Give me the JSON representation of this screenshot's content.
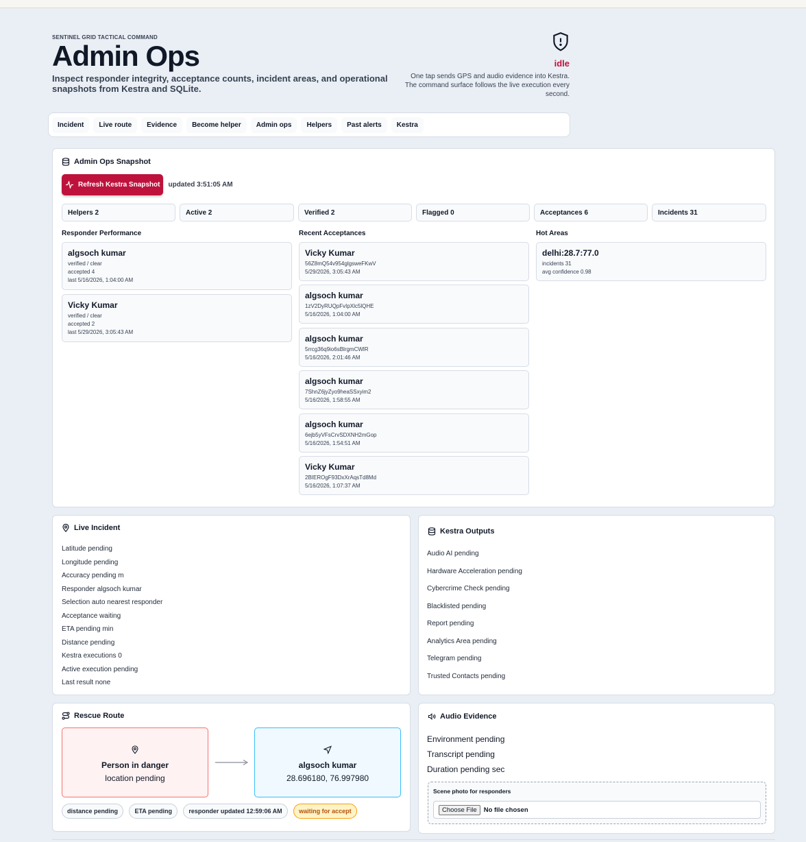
{
  "header": {
    "eyebrow": "SENTINEL GRID TACTICAL COMMAND",
    "title": "Admin Ops",
    "subtitle": "Inspect responder integrity, acceptance counts, incident areas, and operational snapshots from Kestra and SQLite.",
    "status": "idle",
    "status_desc": "One tap sends GPS and audio evidence into Kestra. The command surface follows the live execution every second.",
    "status_color": "#be123c"
  },
  "nav": {
    "tabs": [
      "Incident",
      "Live route",
      "Evidence",
      "Become helper",
      "Admin ops",
      "Helpers",
      "Past alerts",
      "Kestra"
    ]
  },
  "admin": {
    "title": "Admin Ops Snapshot",
    "refresh_label": "Refresh Kestra Snapshot",
    "updated": "updated 3:51:05 AM",
    "stats": [
      "Helpers 2",
      "Active 2",
      "Verified 2",
      "Flagged 0",
      "Acceptances 6",
      "Incidents 31"
    ],
    "performance": {
      "title": "Responder Performance",
      "items": [
        {
          "name": "algsoch kumar",
          "status": "verified / clear",
          "accepted": "accepted 4",
          "last": "last 5/16/2026, 1:04:00 AM"
        },
        {
          "name": "Vicky Kumar",
          "status": "verified / clear",
          "accepted": "accepted 2",
          "last": "last 5/29/2026, 3:05:43 AM"
        }
      ]
    },
    "acceptances": {
      "title": "Recent Acceptances",
      "items": [
        {
          "name": "Vicky Kumar",
          "id": "56Z8mQ54v954glgsweFKwV",
          "time": "5/29/2026, 3:05:43 AM"
        },
        {
          "name": "algsoch kumar",
          "id": "1zV2DyRUQpFvIpXlc5lQHE",
          "time": "5/16/2026, 1:04:00 AM"
        },
        {
          "name": "algsoch kumar",
          "id": "5rrcg36q9io6sBlrgmCWlR",
          "time": "5/16/2026, 2:01:46 AM"
        },
        {
          "name": "algsoch kumar",
          "id": "7ShnZ6jyZyo9heaSSxyim2",
          "time": "5/16/2026, 1:58:55 AM"
        },
        {
          "name": "algsoch kumar",
          "id": "6ejb5yVFsCrvSDXNH2mGop",
          "time": "5/16/2026, 1:54:51 AM"
        },
        {
          "name": "Vicky Kumar",
          "id": "2BIEROgF93DxXrAqsTd8Md",
          "time": "5/16/2026, 1:07:37 AM"
        }
      ]
    },
    "hot_areas": {
      "title": "Hot Areas",
      "items": [
        {
          "name": "delhi:28.7:77.0",
          "incidents": "incidents 31",
          "confidence": "avg confidence 0.98"
        }
      ]
    }
  },
  "live_incident": {
    "title": "Live Incident",
    "fields": [
      "Latitude pending",
      "Longitude pending",
      "Accuracy pending m",
      "Responder algsoch kumar",
      "Selection auto nearest responder",
      "Acceptance waiting",
      "ETA pending min",
      "Distance pending",
      "Kestra executions 0",
      "Active execution pending",
      "Last result none"
    ]
  },
  "kestra_outputs": {
    "title": "Kestra Outputs",
    "fields": [
      "Audio AI pending",
      "Hardware Acceleration pending",
      "Cybercrime Check pending",
      "Blacklisted pending",
      "Report pending",
      "Analytics Area pending",
      "Telegram pending",
      "Trusted Contacts pending"
    ]
  },
  "route": {
    "title": "Rescue Route",
    "from": {
      "title": "Person in danger",
      "detail": "location pending"
    },
    "to": {
      "title": "algsoch kumar",
      "detail": "28.696180, 76.997980"
    },
    "chips": [
      "distance pending",
      "ETA pending",
      "responder updated 12:59:06 AM",
      "waiting for accept"
    ]
  },
  "audio": {
    "title": "Audio Evidence",
    "fields": [
      "Environment pending",
      "Transcript pending",
      "Duration pending sec"
    ],
    "upload_label": "Scene photo for responders",
    "choose_label": "Choose File",
    "no_file": "No file chosen"
  }
}
